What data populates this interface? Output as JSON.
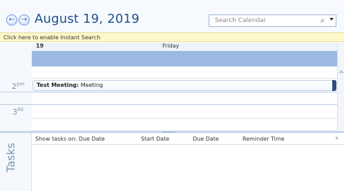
{
  "header": {
    "back_icon": "back-arrow-icon",
    "forward_icon": "forward-arrow-icon",
    "date_title": "August 19, 2019",
    "search_placeholder": "Search Calendar",
    "search_icon": "magnifier-icon"
  },
  "infobar": {
    "text": "Click here to enable Instant Search"
  },
  "day": {
    "number": "19",
    "name": "Friday"
  },
  "time_labels": [
    {
      "hour": "2",
      "suffix": "pm"
    },
    {
      "hour": "3",
      "suffix": "00"
    }
  ],
  "appointment": {
    "title": "Test Meeting:",
    "location": " Meeting"
  },
  "tasks": {
    "label": "Tasks",
    "columns": [
      "Show tasks on: Due Date",
      "Start Date",
      "Due Date",
      "Reminder Time"
    ],
    "expand_icon": "double-chevron-down-icon"
  },
  "colors": {
    "accent": "#1f4f8c",
    "allday_band": "#9cb9e2",
    "infobar_bg": "#fff9c9",
    "appointment_bar": "#2c4d7d"
  }
}
